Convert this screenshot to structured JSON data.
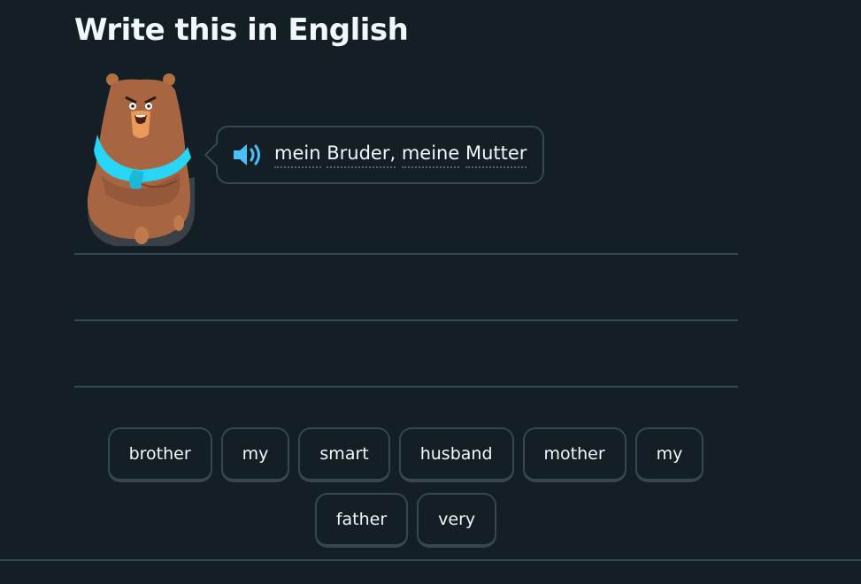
{
  "header": {
    "title": "Write this in English"
  },
  "prompt": {
    "words": [
      "mein",
      "Bruder,",
      "meine",
      "Mutter"
    ],
    "speaker_icon": "speaker-icon",
    "accent_color": "#49c0f8"
  },
  "character": {
    "icon": "bear-character"
  },
  "word_bank": {
    "row1": [
      "brother",
      "my",
      "smart",
      "husband",
      "mother",
      "my"
    ],
    "row2": [
      "father",
      "very"
    ]
  },
  "colors": {
    "background": "#131f24",
    "border": "#37464f",
    "text": "#f1f7fb"
  }
}
